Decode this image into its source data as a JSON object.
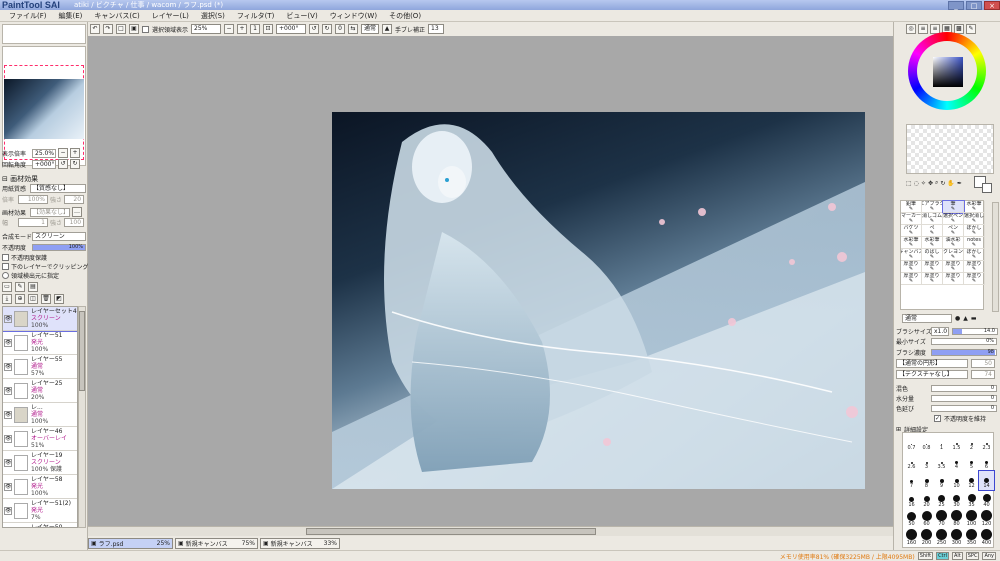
{
  "app": {
    "logo": "PaintTool SAI",
    "title": "atiki / ビクチャ / 仕事 / wacom / ラフ.psd (*)"
  },
  "menu": [
    "ファイル(F)",
    "編集(E)",
    "キャンバス(C)",
    "レイヤー(L)",
    "選択(S)",
    "フィルタ(T)",
    "ビュー(V)",
    "ウィンドウ(W)",
    "その他(O)"
  ],
  "toolbar": {
    "selection_label": "選択領域表示",
    "zoom": "25%",
    "angle": "+000°",
    "blend": "通常",
    "stabilizer_label": "手ブレ補正",
    "stabilizer": "13"
  },
  "navigator": {
    "zoom_label": "表示倍率",
    "zoom": "25.0%",
    "angle_label": "回転角度",
    "angle": "+000°"
  },
  "paper": {
    "section": "画材効果",
    "texture_label": "用紙質感",
    "texture": "【質感なし】",
    "magnify_label": "倍率",
    "magnify": "100%",
    "strength_label": "強さ",
    "strength": "20",
    "effect_label": "画材効果",
    "effect": "【効果なし】",
    "effect_width_label": "幅",
    "effect_width": "1",
    "effect_strength_label": "強さ",
    "effect_strength": "100"
  },
  "layer_props": {
    "blend_label": "合成モード",
    "blend": "スクリーン",
    "opacity_label": "不透明度",
    "opacity": "100%",
    "opacity_value": 100,
    "preserve_opacity": "不透明度保護",
    "clip": "下のレイヤーでクリッピング",
    "selection_source": "領域検出元に指定"
  },
  "layers": [
    {
      "name": "レイヤーセット4",
      "mode": "スクリーン",
      "pct": "100%",
      "selected": true,
      "folder": true
    },
    {
      "name": "レイヤー51",
      "mode": "発光",
      "pct": "100%"
    },
    {
      "name": "レイヤー55",
      "mode": "通常",
      "pct": "57%"
    },
    {
      "name": "レイヤー25",
      "mode": "通常",
      "pct": "20%"
    },
    {
      "name": "レ...",
      "mode": "通常",
      "pct": "100%",
      "folder": true
    },
    {
      "name": "レイヤー46",
      "mode": "オーバーレイ",
      "pct": "51%"
    },
    {
      "name": "レイヤー19",
      "mode": "スクリーン",
      "pct": "100% 保護"
    },
    {
      "name": "レイヤー58",
      "mode": "発光",
      "pct": "100%"
    },
    {
      "name": "レイヤー51(2)",
      "mode": "発光",
      "pct": "7%"
    },
    {
      "name": "レイヤー50",
      "mode": "オーバーレイ",
      "pct": "100%"
    }
  ],
  "tabs": [
    {
      "name": "ラフ.psd",
      "zoom": "25%",
      "active": true
    },
    {
      "name": "新規キャンバス",
      "zoom": "75%"
    },
    {
      "name": "新規キャンバス",
      "zoom": "33%"
    }
  ],
  "status": {
    "memory": "メモリ使用率81% (確保3225MB / 上限4095MB)",
    "keys": [
      "Shift",
      "Ctrl",
      "Alt",
      "SPC",
      "Any"
    ]
  },
  "tools": [
    {
      "label": "鉛筆"
    },
    {
      "label": "エアブラシ"
    },
    {
      "label": "筆",
      "selected": true
    },
    {
      "label": "水彩筆"
    },
    {
      "label": "マーカー"
    },
    {
      "label": "消しゴム"
    },
    {
      "label": "選択ペン"
    },
    {
      "label": "選択消し"
    },
    {
      "label": "バケツ"
    },
    {
      "label": "ペ"
    },
    {
      "label": "ペン"
    },
    {
      "label": "ぼかし"
    },
    {
      "label": "水彩筆"
    },
    {
      "label": "水彩筆"
    },
    {
      "label": "油水彩"
    },
    {
      "label": "notes"
    },
    {
      "label": "キャンバス"
    },
    {
      "label": "のばし"
    },
    {
      "label": "クレヨン"
    },
    {
      "label": "ぼかし"
    },
    {
      "label": "厚塗り"
    },
    {
      "label": "厚塗り"
    },
    {
      "label": "厚塗り"
    },
    {
      "label": "厚塗り"
    },
    {
      "label": "厚塗り"
    },
    {
      "label": "厚塗り"
    },
    {
      "label": "厚塗り"
    },
    {
      "label": "厚塗り"
    }
  ],
  "brush": {
    "mode": "通常",
    "size_label": "ブラシサイズ",
    "size_mult": "x1.0",
    "size": "14.0",
    "min_label": "最小サイズ",
    "min": "0%",
    "density_label": "ブラシ濃度",
    "density": "98",
    "density_value": 98,
    "shape": "【通常の円形】",
    "texture": "【テクスチャなし】",
    "shape_value": "50",
    "texture_value": "74",
    "blend_label": "混色",
    "blend": "0",
    "water_label": "水分量",
    "water": "0",
    "stretch_label": "色延び",
    "stretch": "0",
    "keep_opacity": "不透明度を維持",
    "detail": "詳細設定"
  },
  "sizes": [
    "0.7",
    "0.8",
    "1",
    "1.5",
    "2",
    "2.3",
    "2.6",
    "3",
    "3.5",
    "4",
    "5",
    "6",
    "7",
    "8",
    "9",
    "10",
    "12",
    "14",
    "16",
    "20",
    "25",
    "30",
    "35",
    "40",
    "50",
    "60",
    "70",
    "80",
    "100",
    "120",
    "160",
    "200",
    "250",
    "300",
    "350",
    "400"
  ],
  "colors": {
    "accent": "#6a6ee0",
    "memory": "#e07a10",
    "mode_text": "#b21b8d"
  }
}
